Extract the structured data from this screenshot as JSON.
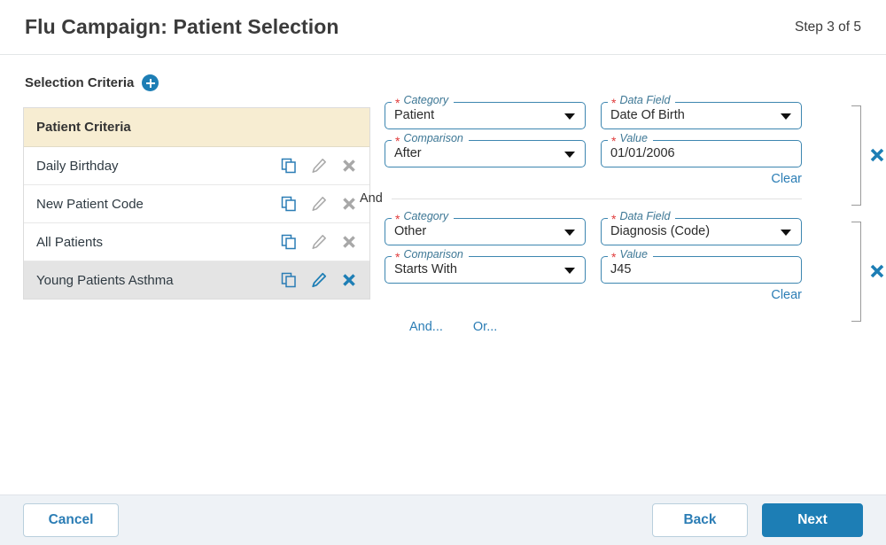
{
  "header": {
    "title": "Flu Campaign: Patient Selection",
    "step": "Step 3 of 5"
  },
  "section": {
    "title": "Selection Criteria",
    "add_icon": "plus-circle-icon"
  },
  "criteria_list": {
    "header": "Patient Criteria",
    "rows": [
      {
        "name": "Daily Birthday",
        "selected": false
      },
      {
        "name": "New Patient Code",
        "selected": false
      },
      {
        "name": "All Patients",
        "selected": false
      },
      {
        "name": "Young Patients Asthma",
        "selected": true
      }
    ],
    "row_icons": [
      "copy-icon",
      "edit-pencil-icon",
      "delete-x-icon"
    ]
  },
  "groups": [
    {
      "category": {
        "label": "Category",
        "value": "Patient",
        "required": "*"
      },
      "data_field": {
        "label": "Data Field",
        "value": "Date Of Birth",
        "required": "*"
      },
      "comparison": {
        "label": "Comparison",
        "value": "After",
        "required": "*"
      },
      "value": {
        "label": "Value",
        "value": "01/01/2006",
        "required": "*"
      },
      "clear_label": "Clear",
      "delete_icon": "delete-x-icon"
    },
    {
      "category": {
        "label": "Category",
        "value": "Other",
        "required": "*"
      },
      "data_field": {
        "label": "Data Field",
        "value": "Diagnosis (Code)",
        "required": "*"
      },
      "comparison": {
        "label": "Comparison",
        "value": "Starts With",
        "required": "*"
      },
      "value": {
        "label": "Value",
        "value": "J45",
        "required": "*"
      },
      "clear_label": "Clear",
      "delete_icon": "delete-x-icon"
    }
  ],
  "connector": {
    "label": "And"
  },
  "add_links": {
    "and": "And...",
    "or": "Or..."
  },
  "footer": {
    "cancel": "Cancel",
    "back": "Back",
    "next": "Next"
  },
  "colors": {
    "accent_blue": "#1d7eb5",
    "link_blue": "#2b7db5",
    "field_border": "#3d86b0",
    "required_red": "#e03b3b",
    "table_header_cream": "#f7edd2",
    "selected_row_gray": "#e4e4e4",
    "footer_bg": "#eef2f6"
  }
}
